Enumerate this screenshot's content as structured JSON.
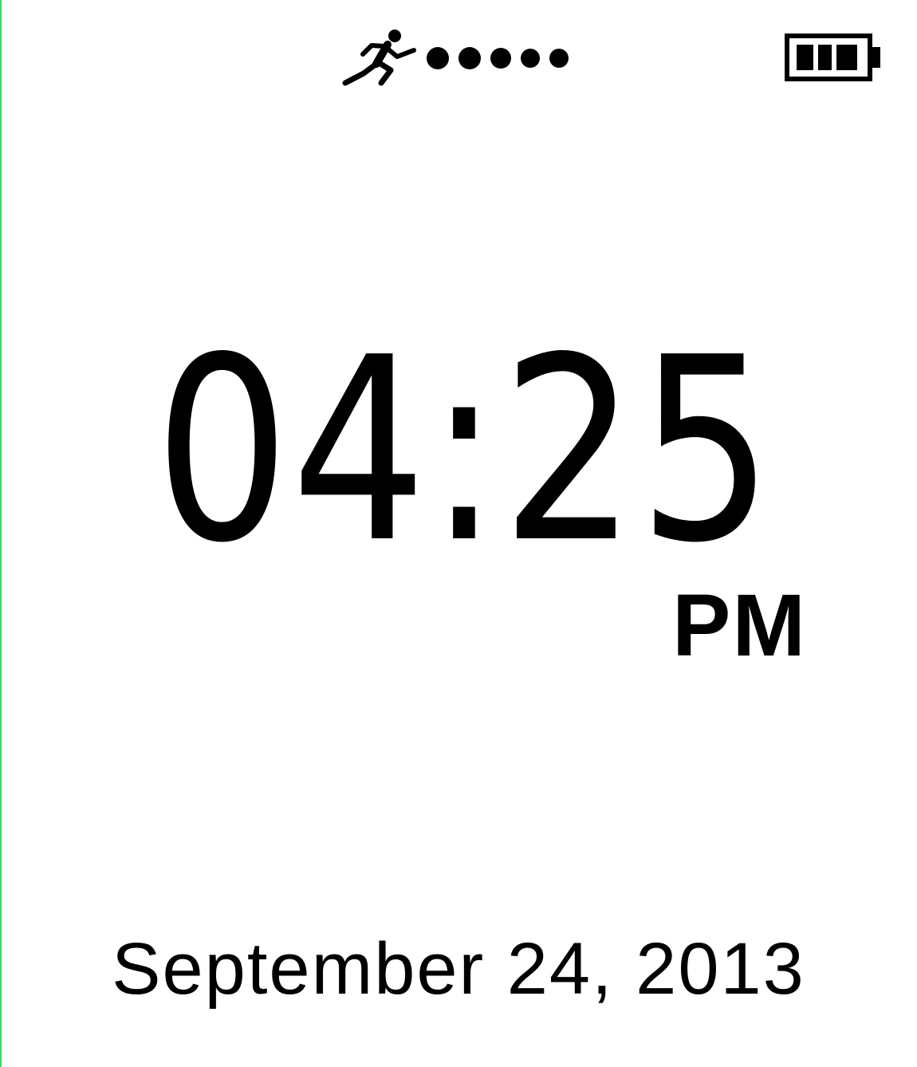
{
  "status": {
    "activity_icon": "runner-icon",
    "progress_dots": 5,
    "battery_icon": "battery-icon",
    "battery_level": 0.75
  },
  "clock": {
    "time": "04:25",
    "ampm": "PM"
  },
  "date": "September 24, 2013",
  "colors": {
    "background": "#ffffff",
    "foreground": "#000000",
    "edge": "#3ddc5a"
  }
}
